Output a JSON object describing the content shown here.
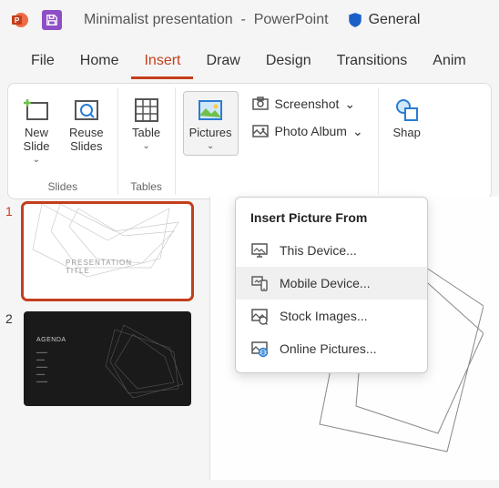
{
  "titlebar": {
    "doc_title": "Minimalist presentation",
    "app_name": "PowerPoint",
    "sensitivity": "General"
  },
  "tabs": [
    "File",
    "Home",
    "Insert",
    "Draw",
    "Design",
    "Transitions",
    "Anim"
  ],
  "active_tab": "Insert",
  "ribbon": {
    "groups": [
      {
        "label": "Slides",
        "buttons": [
          {
            "label": "New\nSlide",
            "dropdown": true,
            "name": "new-slide-button"
          },
          {
            "label": "Reuse\nSlides",
            "dropdown": false,
            "name": "reuse-slides-button"
          }
        ]
      },
      {
        "label": "Tables",
        "buttons": [
          {
            "label": "Table",
            "dropdown": true,
            "name": "table-button"
          }
        ]
      },
      {
        "label": "",
        "buttons": [
          {
            "label": "Pictures",
            "dropdown": true,
            "name": "pictures-button",
            "active": true
          }
        ],
        "mini": [
          {
            "label": "Screenshot",
            "name": "screenshot-button",
            "dropdown": true
          },
          {
            "label": "Photo Album",
            "name": "photo-album-button",
            "dropdown": true
          }
        ]
      },
      {
        "label": "",
        "buttons": [
          {
            "label": "Shap",
            "dropdown": false,
            "name": "shapes-button"
          }
        ]
      }
    ]
  },
  "dropdown": {
    "header": "Insert Picture From",
    "items": [
      {
        "label": "This Device...",
        "name": "this-device-item"
      },
      {
        "label": "Mobile Device...",
        "name": "mobile-device-item",
        "hover": true
      },
      {
        "label": "Stock Images...",
        "name": "stock-images-item"
      },
      {
        "label": "Online Pictures...",
        "name": "online-pictures-item"
      }
    ]
  },
  "thumbs": [
    {
      "num": "1",
      "selected": true,
      "title": "PRESENTATION TITLE"
    },
    {
      "num": "2",
      "dark": true,
      "agenda": "AGENDA"
    }
  ]
}
